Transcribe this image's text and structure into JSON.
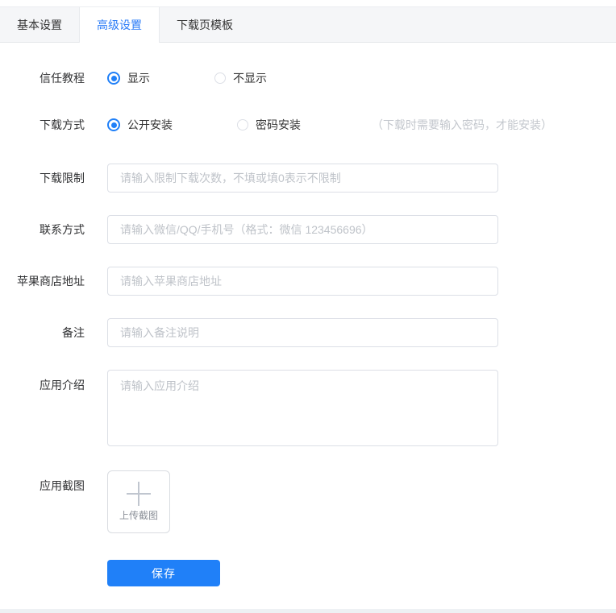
{
  "tabs": [
    {
      "label": "基本设置",
      "active": false
    },
    {
      "label": "高级设置",
      "active": true
    },
    {
      "label": "下载页模板",
      "active": false
    }
  ],
  "form": {
    "trust": {
      "label": "信任教程",
      "options": [
        {
          "label": "显示",
          "selected": true
        },
        {
          "label": "不显示",
          "selected": false
        }
      ]
    },
    "method": {
      "label": "下载方式",
      "options": [
        {
          "label": "公开安装",
          "selected": true
        },
        {
          "label": "密码安装",
          "selected": false,
          "note": "（下载时需要输入密码，才能安装）"
        }
      ]
    },
    "limit": {
      "label": "下载限制",
      "placeholder": "请输入限制下载次数，不填或填0表示不限制",
      "value": ""
    },
    "contact": {
      "label": "联系方式",
      "placeholder": "请输入微信/QQ/手机号（格式：微信 123456696）",
      "value": ""
    },
    "appstore": {
      "label": "苹果商店地址",
      "placeholder": "请输入苹果商店地址",
      "value": ""
    },
    "remark": {
      "label": "备注",
      "placeholder": "请输入备注说明",
      "value": ""
    },
    "intro": {
      "label": "应用介绍",
      "placeholder": "请输入应用介绍",
      "value": ""
    },
    "screenshot": {
      "label": "应用截图",
      "upload_text": "上传截图"
    },
    "save_label": "保存"
  },
  "colors": {
    "accent": "#2080f8",
    "tab_bar_bg": "#f5f6f8",
    "border": "#dcdfe6",
    "placeholder": "#bfc3c9"
  }
}
